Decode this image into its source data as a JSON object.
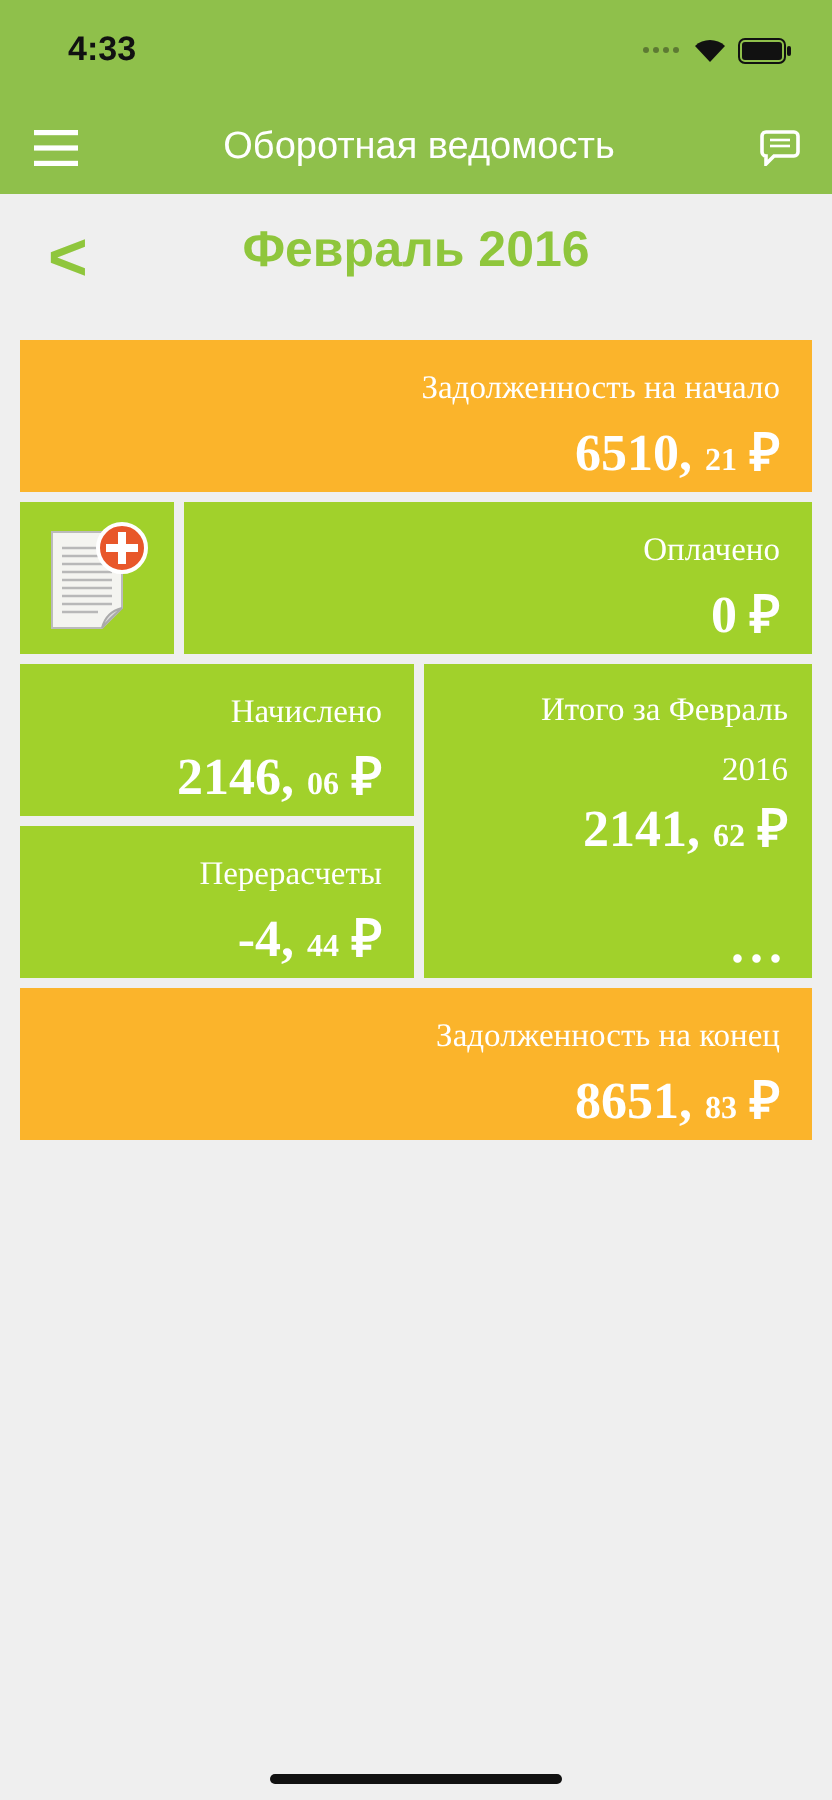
{
  "status_bar": {
    "time": "4:33"
  },
  "nav_bar": {
    "title": "Оборотная ведомость"
  },
  "period": {
    "back": "<",
    "title": "Февраль 2016"
  },
  "tiles": [
    {
      "kind": "wide",
      "color": "#fbb42b",
      "label": "Задолженность на начало",
      "amount": {
        "whole": "6510,",
        "fraction": "21",
        "currency": "₽"
      }
    },
    {
      "kind": "paid",
      "color": "#a1d12b",
      "label": "Оплачено",
      "amount": {
        "whole": "0",
        "currency": "₽"
      }
    },
    {
      "kind": "stack",
      "tiles": [
        {
          "kind": "small",
          "color": "#a1d12b",
          "label": "Начислено",
          "amount": {
            "whole": "2146,",
            "fraction": "06",
            "currency": "₽"
          }
        },
        {
          "kind": "small",
          "color": "#a1d12b",
          "label": "Перерасчеты",
          "amount": {
            "whole": "-4,",
            "fraction": "44",
            "currency": "₽"
          }
        }
      ]
    },
    {
      "kind": "total",
      "color": "#a1d12b",
      "label": "Итого за Февраль 2016",
      "amount": {
        "whole": "2141,",
        "fraction": "62",
        "currency": "₽"
      },
      "more": "..."
    },
    {
      "kind": "wide",
      "color": "#fbb42b",
      "label": "Задолженность на конец",
      "amount": {
        "whole": "8651,",
        "fraction": "83",
        "currency": "₽"
      }
    }
  ]
}
